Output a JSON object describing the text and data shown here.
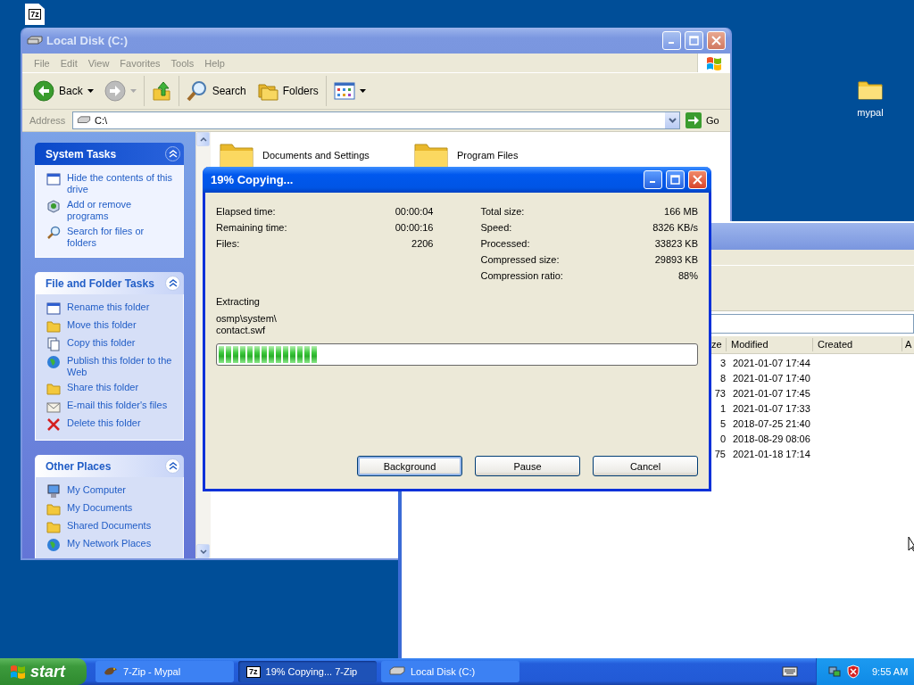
{
  "desktop_file": {
    "badge": "7z"
  },
  "desktop_folder": {
    "label": "mypal"
  },
  "explorer": {
    "title": "Local Disk (C:)",
    "menu": [
      "File",
      "Edit",
      "View",
      "Favorites",
      "Tools",
      "Help"
    ],
    "toolbar": [
      "Back",
      "Search",
      "Folders"
    ],
    "address": {
      "label": "Address",
      "value": "C:\\",
      "go": "Go"
    },
    "panels": [
      {
        "title": "System Tasks",
        "kind": "special",
        "items": [
          "Hide the contents of this drive",
          "Add or remove programs",
          "Search for files or folders"
        ]
      },
      {
        "title": "File and Folder Tasks",
        "kind": "normal",
        "items": [
          "Rename this folder",
          "Move this folder",
          "Copy this folder",
          "Publish this folder to the Web",
          "Share this folder",
          "E-mail this folder's files",
          "Delete this folder"
        ]
      },
      {
        "title": "Other Places",
        "kind": "normal",
        "items": [
          "My Computer",
          "My Documents",
          "Shared Documents",
          "My Network Places"
        ]
      }
    ],
    "folders": [
      "Documents and Settings",
      "Program Files"
    ]
  },
  "archive_window": {
    "columns": [
      "ze",
      "Modified",
      "Created",
      "A"
    ],
    "rows": [
      {
        "size": "3",
        "modified": "2021-01-07 17:44"
      },
      {
        "size": "8",
        "modified": "2021-01-07 17:40"
      },
      {
        "size": "73",
        "modified": "2021-01-07 17:45"
      },
      {
        "size": "1",
        "modified": "2021-01-07 17:33"
      },
      {
        "size": "5",
        "modified": "2018-07-25 21:40"
      },
      {
        "size": "0",
        "modified": "2018-08-29 08:06"
      },
      {
        "size": "75",
        "modified": "2021-01-18 17:14"
      }
    ]
  },
  "dialog": {
    "title": "19% Copying...",
    "stats_left": [
      {
        "label": "Elapsed time:",
        "value": "00:00:04"
      },
      {
        "label": "Remaining time:",
        "value": "00:00:16"
      },
      {
        "label": "Files:",
        "value": "2206"
      }
    ],
    "stats_right": [
      {
        "label": "Total size:",
        "value": "166 MB"
      },
      {
        "label": "Speed:",
        "value": "8326 KB/s"
      },
      {
        "label": "Processed:",
        "value": "33823 KB"
      },
      {
        "label": "Compressed size:",
        "value": "29893 KB"
      },
      {
        "label": "Compression ratio:",
        "value": "88%"
      }
    ],
    "action": "Extracting",
    "path": [
      "osmp\\system\\",
      "contact.swf"
    ],
    "level": 0.21,
    "buttons": [
      {
        "label": "Background",
        "default": true
      },
      {
        "label": "Pause",
        "default": false
      },
      {
        "label": "Cancel",
        "default": false
      }
    ]
  },
  "taskbar": {
    "start": "start",
    "items": [
      {
        "label": "7-Zip - Mypal",
        "selected": false
      },
      {
        "badge": "7z",
        "label": "19% Copying... 7-Zip",
        "selected": true
      },
      {
        "label": "Local Disk (C:)",
        "selected": false
      }
    ],
    "clock": "9:55 AM"
  }
}
